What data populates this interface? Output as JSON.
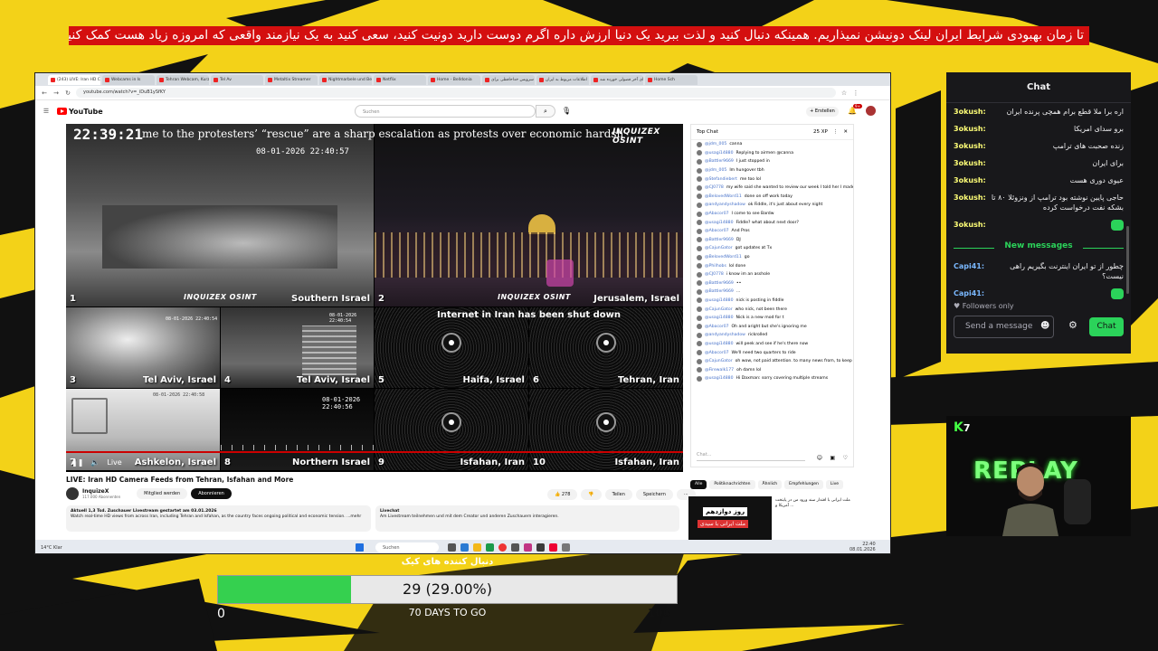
{
  "banner": {
    "text": "تا زمان بهبودی شرایط ایران لینک دونیشن نمیذاریم. همینکه دنبال کنید و لذت ببرید یک دنیا ارزش داره اگرم دوست دارید دونیت کنید، سعی کنید به یک نیازمند واقعی که امروزه زیاد هست کمک کنید."
  },
  "browser": {
    "tabs": [
      "(243) LIVE: Iran HD Came",
      "Webcams in Is",
      "Tehran Webcam, Kurz",
      "Tel Av",
      "Metaltix Streamer",
      "Nightmarbele und Begin",
      "Netflix",
      "Home - Belldonia",
      "سرویس خداحافظی برای",
      "اطلاعات مربوط به ایران",
      "ای آخر فضولی خورده شد",
      "Home Sch"
    ],
    "url": "youtube.com/watch?v=_iDuB1ySfKY",
    "search_placeholder": "Suchen",
    "create_label": "+ Erstellen",
    "notif_count": "9+"
  },
  "video": {
    "clock": "22:39:21",
    "ticker": "me to the protesters’ “rescue” are a sharp escalation as protests over economic hardsh",
    "brand": "INQUIZEX OSINT",
    "timestamp_big": "08-01-2026 22:40:57",
    "timestamp_small": "08-01-2026 22:40:54",
    "timestamp_ashkelon": "08-01-2026 22:40:58",
    "timestamp_northern": "08-01-2026 22:40:56",
    "internet_notice": "Internet in Iran has been shut down",
    "feeds": [
      {
        "num": "1",
        "label": "Southern Israel"
      },
      {
        "num": "2",
        "label": "Jerusalem, Israel"
      },
      {
        "num": "3",
        "label": "Tel Aviv, Israel"
      },
      {
        "num": "4",
        "label": "Tel Aviv, Israel"
      },
      {
        "num": "5",
        "label": "Haifa, Israel"
      },
      {
        "num": "6",
        "label": "Tehran, Iran"
      },
      {
        "num": "7",
        "label": "Ashkelon, Israel"
      },
      {
        "num": "8",
        "label": "Northern Israel"
      },
      {
        "num": "9",
        "label": "Isfahan, Iran"
      },
      {
        "num": "10",
        "label": "Isfahan, Iran"
      }
    ],
    "live_label": "Live",
    "title": "LIVE: Iran HD Camera Feeds from Tehran, Isfahan and More",
    "channel": "InquizeX",
    "subscribers": "117.000 Abonnenten",
    "join_label": "Mitglied werden",
    "subscribe_label": "Abonnieren",
    "likes": "278",
    "share_label": "Teilen",
    "save_label": "Speichern",
    "desc_head": "Aktuell 1,3 Tsd. Zuschauer  Livestream gestartet am 03.01.2026",
    "desc_body": "Watch real-time HD views from across Iran, including Tehran and Isfahan, as the country faces ongoing political and economic tension. ...mehr",
    "livechat_head": "Livechat",
    "livechat_body": "Am Livestream teilnehmen und mit dem Creator und anderen Zuschauern interagieren."
  },
  "ytchat": {
    "title": "Top Chat",
    "points": "25 XP",
    "messages": [
      {
        "user": "@jdm_005",
        "text": "canna"
      },
      {
        "user": "@usagi14880",
        "text": "Replying to airmen @canna"
      },
      {
        "user": "@Battler9669",
        "text": "I just stopped in"
      },
      {
        "user": "@jdm_005",
        "text": "Im hungover tbh"
      },
      {
        "user": "@Stefandiebert",
        "text": "me too lol"
      },
      {
        "user": "@CJ0778",
        "text": "my wife said she wanted to review our week I told her I made the mistake"
      },
      {
        "user": "@BelovedWord11",
        "text": "done on off work today"
      },
      {
        "user": "@andyandyshadow",
        "text": "ok Fiddle, it's just about every night"
      },
      {
        "user": "@Abacor07",
        "text": "I come to see Bardw"
      },
      {
        "user": "@usagi14880",
        "text": "Fiddle? what about next door?"
      },
      {
        "user": "@Abacor07",
        "text": "And Pros"
      },
      {
        "user": "@Battler9669",
        "text": "DJ"
      },
      {
        "user": "@CajunGator",
        "text": "got updates at Tx"
      },
      {
        "user": "@BelovedWord11",
        "text": "go"
      },
      {
        "user": "@Philhobs",
        "text": "lol done"
      },
      {
        "user": "@CJ0778",
        "text": "i know im an asshole"
      },
      {
        "user": "@Battler9669",
        "text": "••"
      },
      {
        "user": "@Battler9669",
        "text": "..."
      },
      {
        "user": "@usagi14880",
        "text": "nick is posting in fiddle"
      },
      {
        "user": "@CajunGator",
        "text": "who nick, not been there"
      },
      {
        "user": "@usagi14880",
        "text": "Nick is a new mod for t"
      },
      {
        "user": "@Abacor07",
        "text": "Oh and aright but she's ignoring me"
      },
      {
        "user": "@andyandyshadow",
        "text": "rickrolled"
      },
      {
        "user": "@usagi14880",
        "text": "will peek and see if he's there now"
      },
      {
        "user": "@Abacor07",
        "text": "We'll need two quarters to ride"
      },
      {
        "user": "@CajunGator",
        "text": "oh wow, not paid attention. to many news from, to keep up with"
      },
      {
        "user": "@Firewalk177",
        "text": "oh damn lol"
      },
      {
        "user": "@usagi14880",
        "text": "Hi Daxman: sorry covering multiple streams"
      }
    ],
    "input_placeholder": "Chat..."
  },
  "chips": [
    "Alle",
    "Politiknachrichten",
    "Ähnlich",
    "Empfehlungen",
    "Live"
  ],
  "recommendation": {
    "thumb_text": "روز دوازدهم",
    "thumb_sub": "ملت ایرانی با سیدی",
    "text": "ملت ایرانی با اقتدار سند ورود من در پایتخت آمریکا و ..."
  },
  "taskbar": {
    "search": "Suchen",
    "weather": "14°C Klar",
    "time": "22:40",
    "date": "08.01.2026"
  },
  "twitch": {
    "title": "Chat",
    "messages": [
      {
        "user": "3okush:",
        "text": "اره برا ملا قطع برام همچی پرنده ایران"
      },
      {
        "user": "3okush:",
        "text": "برو سدای امریکا"
      },
      {
        "user": "3okush:",
        "text": "زنده صحبت های ترامپ"
      },
      {
        "user": "3okush:",
        "text": "برای ایران"
      },
      {
        "user": "3okush:",
        "text": "عیوی دوری هست"
      },
      {
        "user": "3okush:",
        "text": "حاجی پایین نوشته بود ترامپ از ونزوئلا ۸۰ تا بشکه نفت درخواست کرده"
      },
      {
        "user": "3okush:",
        "text": ""
      }
    ],
    "new_messages": "New messages",
    "messages2": [
      {
        "user": "Capi41:",
        "text": "چطور از تو ایران اینترنت بگیریم راهی نیست؟"
      },
      {
        "user": "Capi41:",
        "text": ""
      }
    ],
    "followers_only": "Followers only",
    "send_placeholder": "Send a message",
    "chat_button": "Chat"
  },
  "webcam": {
    "logo": "K",
    "logo_num": "7",
    "neon": "REPLAY"
  },
  "goal": {
    "title": "دنبال کننده های کیک",
    "text": "29 (29.00%)",
    "fraction": 0.29,
    "min": "0",
    "max": "100",
    "days": "70 DAYS TO GO"
  }
}
